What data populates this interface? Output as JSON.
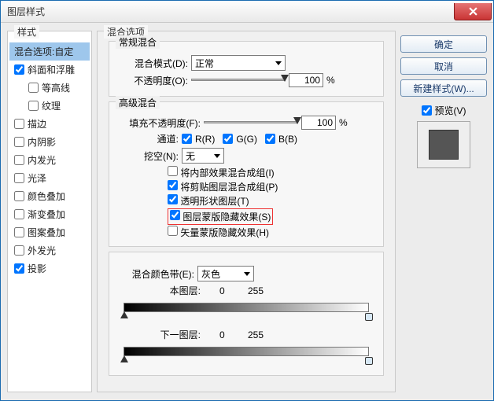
{
  "window": {
    "title": "图层样式"
  },
  "styles_panel": {
    "legend": "样式",
    "items": [
      {
        "label": "混合选项:自定",
        "checked": null,
        "selected": true
      },
      {
        "label": "斜面和浮雕",
        "checked": true
      },
      {
        "label": "等高线",
        "checked": false,
        "child": true
      },
      {
        "label": "纹理",
        "checked": false,
        "child": true
      },
      {
        "label": "描边",
        "checked": false
      },
      {
        "label": "内阴影",
        "checked": false
      },
      {
        "label": "内发光",
        "checked": false
      },
      {
        "label": "光泽",
        "checked": false
      },
      {
        "label": "颜色叠加",
        "checked": false
      },
      {
        "label": "渐变叠加",
        "checked": false
      },
      {
        "label": "图案叠加",
        "checked": false
      },
      {
        "label": "外发光",
        "checked": false
      },
      {
        "label": "投影",
        "checked": true
      }
    ]
  },
  "mid": {
    "legend": "混合选项",
    "normal_blend": {
      "legend": "常规混合",
      "mode_label": "混合模式(D):",
      "mode_value": "正常",
      "opacity_label": "不透明度(O):",
      "opacity_value": "100",
      "percent": "%"
    },
    "adv_blend": {
      "legend": "高级混合",
      "fill_label": "填充不透明度(F):",
      "fill_value": "100",
      "percent": "%",
      "channel_label": "通道:",
      "channel_r": "R(R)",
      "channel_g": "G(G)",
      "channel_b": "B(B)",
      "knockout_label": "挖空(N):",
      "knockout_value": "无",
      "opts": [
        {
          "label": "将内部效果混合成组(I)",
          "checked": false,
          "hl": false
        },
        {
          "label": "将剪贴图层混合成组(P)",
          "checked": true,
          "hl": false
        },
        {
          "label": "透明形状图层(T)",
          "checked": true,
          "hl": false
        },
        {
          "label": "图层蒙版隐藏效果(S)",
          "checked": true,
          "hl": true
        },
        {
          "label": "矢量蒙版隐藏效果(H)",
          "checked": false,
          "hl": false
        }
      ]
    },
    "blend_if": {
      "label": "混合颜色带(E):",
      "value": "灰色",
      "this_layer_label": "本图层:",
      "under_layer_label": "下一图层:",
      "v0": "0",
      "v255": "255"
    }
  },
  "right": {
    "ok": "确定",
    "cancel": "取消",
    "new_style": "新建样式(W)...",
    "preview_label": "预览(V)"
  }
}
